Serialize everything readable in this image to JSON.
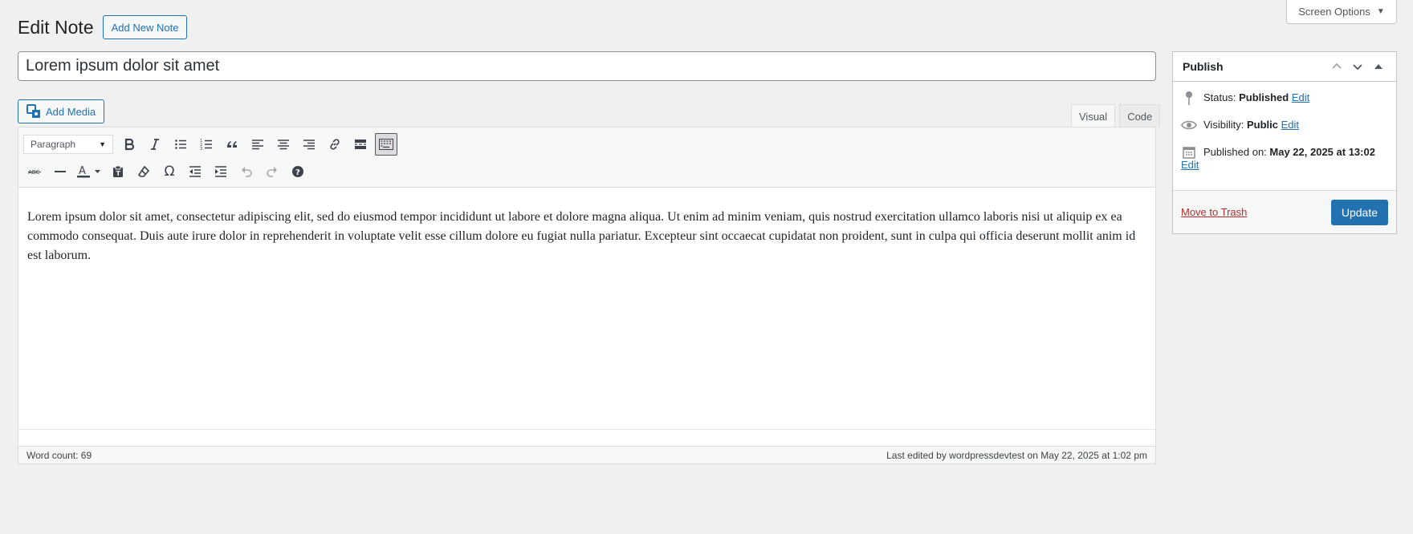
{
  "screen_options": {
    "label": "Screen Options"
  },
  "header": {
    "title": "Edit Note",
    "add_new_label": "Add New Note"
  },
  "post": {
    "title": "Lorem ipsum dolor sit amet"
  },
  "editor": {
    "add_media_label": "Add Media",
    "tabs": [
      {
        "label": "Visual",
        "active": true
      },
      {
        "label": "Code",
        "active": false
      }
    ],
    "format_select": "Paragraph",
    "toolbar_row1_icons": [
      "bold-icon",
      "italic-icon",
      "bullet-list-icon",
      "numbered-list-icon",
      "blockquote-icon",
      "align-left-icon",
      "align-center-icon",
      "align-right-icon",
      "link-icon",
      "read-more-icon",
      "toolbar-toggle-icon"
    ],
    "toolbar_row2_icons": [
      "strikethrough-icon",
      "horizontal-line-icon",
      "text-color-icon",
      "paste-text-icon",
      "clear-formatting-icon",
      "special-character-icon",
      "outdent-icon",
      "indent-icon",
      "undo-icon",
      "redo-icon",
      "help-icon"
    ],
    "content": "Lorem ipsum dolor sit amet, consectetur adipiscing elit, sed do eiusmod tempor incididunt ut labore et dolore magna aliqua. Ut enim ad minim veniam, quis nostrud exercitation ullamco laboris nisi ut aliquip ex ea commodo consequat. Duis aute irure dolor in reprehenderit in voluptate velit esse cillum dolore eu fugiat nulla pariatur. Excepteur sint occaecat cupidatat non proident, sunt in culpa qui officia deserunt mollit anim id est laborum.",
    "word_count": "Word count: 69",
    "last_edited": "Last edited by wordpressdevtest on May 22, 2025 at 1:02 pm"
  },
  "publish": {
    "title": "Publish",
    "status_label": "Status:",
    "status_value": "Published",
    "visibility_label": "Visibility:",
    "visibility_value": "Public",
    "published_label": "Published on:",
    "published_value": "May 22, 2025 at 13:02",
    "edit_label": "Edit",
    "trash_label": "Move to Trash",
    "update_label": "Update"
  },
  "colors": {
    "accent": "#2271b1",
    "trash": "#b32d2e",
    "background": "#f0f0f1"
  }
}
